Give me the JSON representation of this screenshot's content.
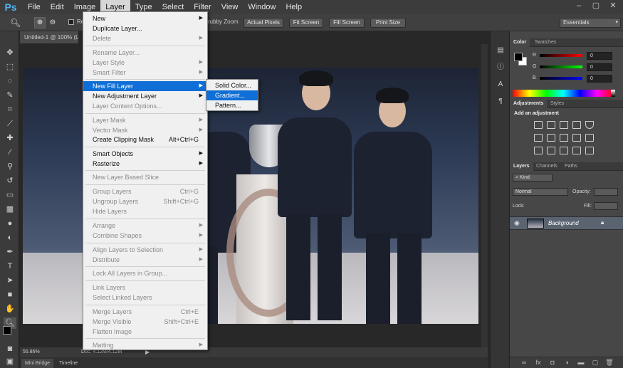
{
  "app": {
    "logo": "Ps"
  },
  "menubar": {
    "items": [
      {
        "label": "File"
      },
      {
        "label": "Edit"
      },
      {
        "label": "Image"
      },
      {
        "label": "Layer"
      },
      {
        "label": "Type"
      },
      {
        "label": "Select"
      },
      {
        "label": "Filter"
      },
      {
        "label": "View"
      },
      {
        "label": "Window"
      },
      {
        "label": "Help"
      }
    ],
    "window_controls": {
      "minimize": "–",
      "restore": "▢",
      "close": "✕"
    }
  },
  "options_bar": {
    "zoom_in_icon": "zoom-in-icon",
    "zoom_out_icon": "zoom-out-icon",
    "resize_windows_partial": "Re",
    "scrubby_zoom_partial": "rubby Zoom",
    "actual_pixels": "Actual Pixels",
    "fit_screen": "Fit Screen",
    "fill_screen": "Fill Screen",
    "print_size": "Print Size",
    "workspace": "Essentials"
  },
  "document": {
    "tab_title": "Untitled-1 @ 100% (L",
    "zoom_level": "55.86%",
    "doc_size": "Doc: 4.12M/4.12M"
  },
  "bottom_tabs": [
    {
      "label": "Mini Bridge"
    },
    {
      "label": "Timeline"
    }
  ],
  "layer_menu": {
    "items": [
      {
        "label": "New",
        "disabled": false,
        "submenu": true
      },
      {
        "label": "Duplicate Layer...",
        "disabled": false
      },
      {
        "label": "Delete",
        "disabled": true,
        "submenu": true
      },
      {
        "label": "Rename Layer...",
        "disabled": true
      },
      {
        "label": "Layer Style",
        "disabled": true,
        "submenu": true
      },
      {
        "label": "Smart Filter",
        "disabled": true,
        "submenu": true
      },
      {
        "label": "New Fill Layer",
        "disabled": false,
        "submenu": true,
        "highlighted": true
      },
      {
        "label": "New Adjustment Layer",
        "disabled": false,
        "submenu": true
      },
      {
        "label": "Layer Content Options...",
        "disabled": true
      },
      {
        "label": "Layer Mask",
        "disabled": true,
        "submenu": true
      },
      {
        "label": "Vector Mask",
        "disabled": true,
        "submenu": true
      },
      {
        "label": "Create Clipping Mask",
        "disabled": false,
        "shortcut": "Alt+Ctrl+G"
      },
      {
        "label": "Smart Objects",
        "disabled": false,
        "submenu": true
      },
      {
        "label": "Rasterize",
        "disabled": false,
        "submenu": true
      },
      {
        "label": "New Layer Based Slice",
        "disabled": true
      },
      {
        "label": "Group Layers",
        "disabled": true,
        "shortcut": "Ctrl+G"
      },
      {
        "label": "Ungroup Layers",
        "disabled": true,
        "shortcut": "Shift+Ctrl+G"
      },
      {
        "label": "Hide Layers",
        "disabled": true
      },
      {
        "label": "Arrange",
        "disabled": true,
        "submenu": true
      },
      {
        "label": "Combine Shapes",
        "disabled": true,
        "submenu": true
      },
      {
        "label": "Align Layers to Selection",
        "disabled": true,
        "submenu": true
      },
      {
        "label": "Distribute",
        "disabled": true,
        "submenu": true
      },
      {
        "label": "Lock All Layers in Group...",
        "disabled": true
      },
      {
        "label": "Link Layers",
        "disabled": true
      },
      {
        "label": "Select Linked Layers",
        "disabled": true
      },
      {
        "label": "Merge Layers",
        "disabled": true,
        "shortcut": "Ctrl+E"
      },
      {
        "label": "Merge Visible",
        "disabled": true,
        "shortcut": "Shift+Ctrl+E"
      },
      {
        "label": "Flatten Image",
        "disabled": true
      },
      {
        "label": "Matting",
        "disabled": true,
        "submenu": true
      }
    ]
  },
  "fill_submenu": {
    "items": [
      {
        "label": "Solid Color..."
      },
      {
        "label": "Gradient...",
        "highlighted": true
      },
      {
        "label": "Pattern..."
      }
    ]
  },
  "color_panel": {
    "tabs": [
      "Color",
      "Swatches"
    ],
    "channels": [
      {
        "label": "R",
        "value": "0"
      },
      {
        "label": "G",
        "value": "0"
      },
      {
        "label": "B",
        "value": "0"
      }
    ]
  },
  "adjustments_panel": {
    "tabs": [
      "Adjustments",
      "Styles"
    ],
    "heading": "Add an adjustment"
  },
  "layers_panel": {
    "tabs": [
      "Layers",
      "Channels",
      "Paths"
    ],
    "filter_kind": "Kind",
    "blend_mode": "Normal",
    "opacity_label": "Opacity:",
    "lock_label": "Lock:",
    "fill_label": "Fill:",
    "layers": [
      {
        "name": "Background",
        "visible": true,
        "locked": true
      }
    ]
  },
  "colors": {
    "menu_highlight": "#0f6fd6",
    "panel_bg": "#474747",
    "app_bg": "#282828"
  }
}
